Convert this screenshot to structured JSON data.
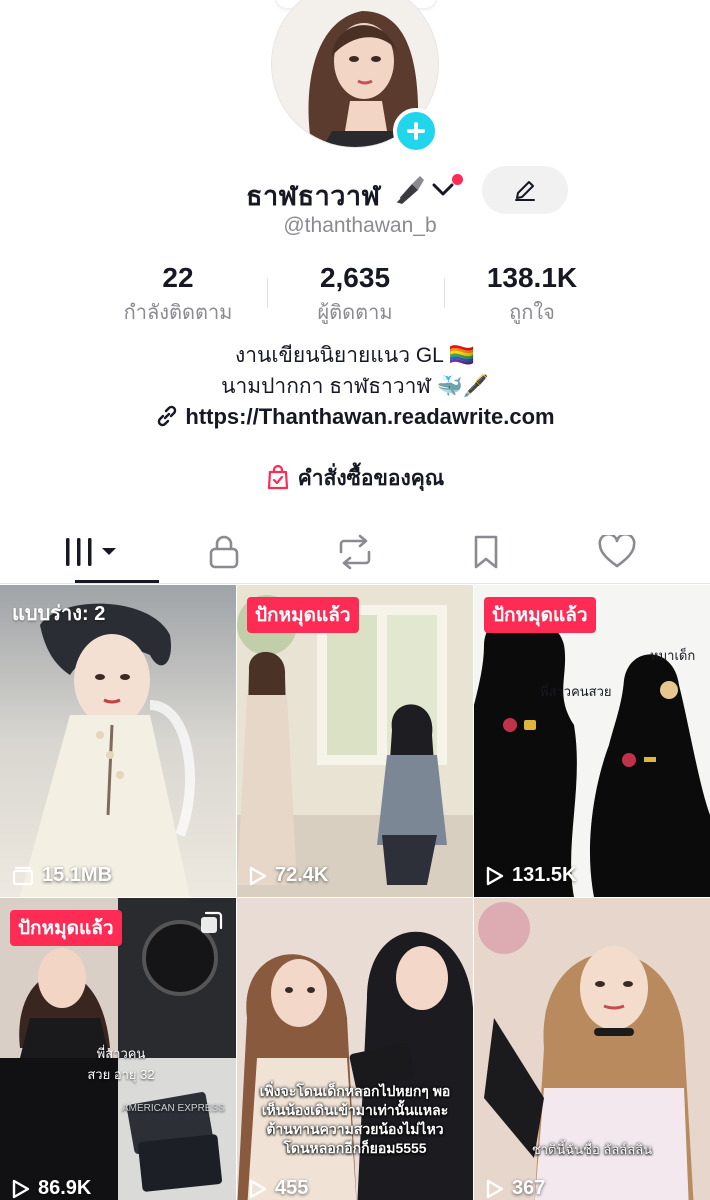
{
  "profile": {
    "display_name": "ธาฬธาวาฬ",
    "handle": "@thanthawan_b",
    "edit_icon": "pencil-icon",
    "add_icon": "plus-icon"
  },
  "stats": [
    {
      "value": "22",
      "label": "กำลังติดตาม"
    },
    {
      "value": "2,635",
      "label": "ผู้ติดตาม"
    },
    {
      "value": "138.1K",
      "label": "ถูกใจ"
    }
  ],
  "bio": {
    "line1": "งานเขียนนิยายแนว GL 🏳️‍🌈",
    "line2": "นามปากกา ธาฬธาวาฬ 🐳🖋️",
    "link": "https://Thanthawan.readawrite.com"
  },
  "orders_label": "คำสั่งซื้อของคุณ",
  "tabs": [
    {
      "icon": "videos-grid-icon"
    },
    {
      "icon": "lock-icon"
    },
    {
      "icon": "repost-icon"
    },
    {
      "icon": "bookmark-icon"
    },
    {
      "icon": "heart-icon"
    }
  ],
  "videos": [
    {
      "badge": "แบบร่าง: 2",
      "count": "15.1MB",
      "count_icon": "drafts-icon"
    },
    {
      "badge": "ปักหมุดแล้ว",
      "count": "72.4K",
      "count_icon": "play-icon"
    },
    {
      "badge": "ปักหมุดแล้ว",
      "count": "131.5K",
      "count_icon": "play-icon",
      "label_a": "หมาเด็ก",
      "label_b": "พี่สาวคนสวย"
    },
    {
      "badge": "ปักหมุดแล้ว",
      "count": "86.9K",
      "count_icon": "play-icon",
      "caption": "พี่สาวคนสวย อายุ 32",
      "card_text": "AMERICAN EXPRESS"
    },
    {
      "badge": "",
      "count": "455",
      "count_icon": "play-icon",
      "caption": "เพิ่งจะโดนเด็กหลอกไปหยกๆ พอเห็นน้องเดินเข้ามาเท่านั้นแหละ ต้านทานความสวยน้องไม่ไหว โดนหลอกอีกก็ยอม5555"
    },
    {
      "badge": "",
      "count": "367",
      "count_icon": "play-icon",
      "caption": "ชาตินี้ฉันชื่อ ลัลล์ลลิน"
    }
  ]
}
